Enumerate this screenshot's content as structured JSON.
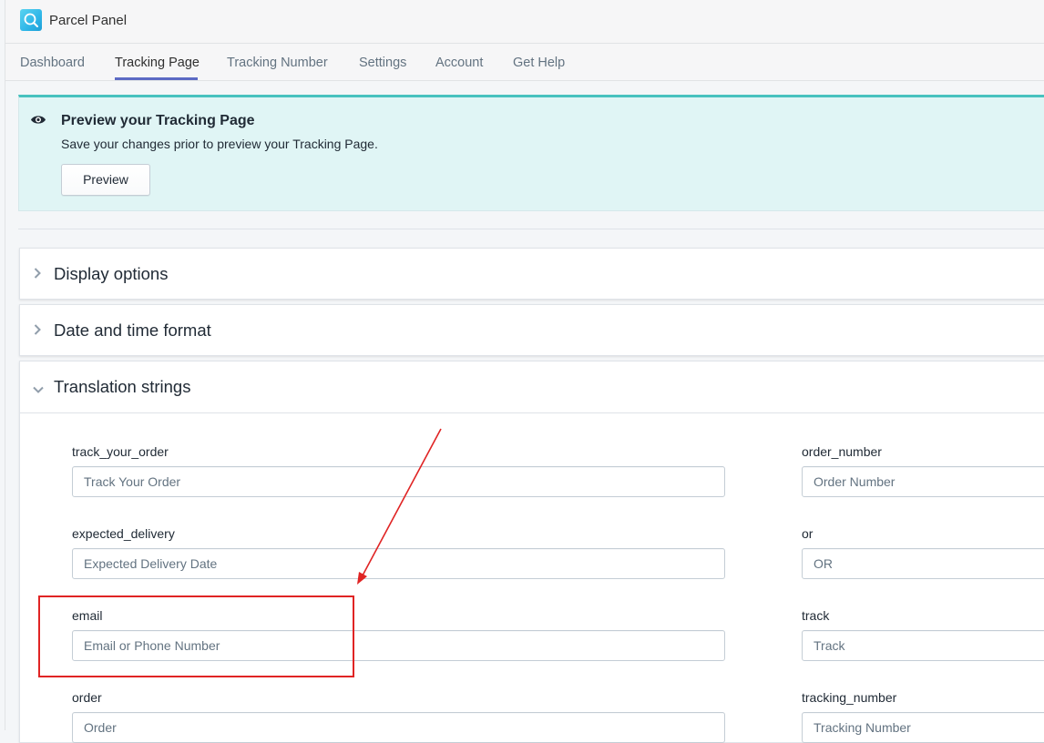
{
  "app": {
    "name": "Parcel Panel",
    "logo_icon": "parcel-panel-search-logo"
  },
  "nav": {
    "tabs": [
      {
        "label": "Dashboard",
        "active": false
      },
      {
        "label": "Tracking Page",
        "active": true
      },
      {
        "label": "Tracking Number",
        "active": false
      },
      {
        "label": "Settings",
        "active": false
      },
      {
        "label": "Account",
        "active": false
      },
      {
        "label": "Get Help",
        "active": false
      }
    ],
    "active_color": "#5c6ac4"
  },
  "banner": {
    "icon": "eye-icon",
    "title": "Preview your Tracking Page",
    "text": "Save your changes prior to preview your Tracking Page.",
    "button_label": "Preview",
    "background": "#e0f5f5",
    "accent": "#47c1bf"
  },
  "sections": {
    "display_options": {
      "title": "Display options",
      "expanded": false
    },
    "date_time_format": {
      "title": "Date and time format",
      "expanded": false
    },
    "translation_strings": {
      "title": "Translation strings",
      "expanded": true
    }
  },
  "translation_fields": {
    "track_your_order": {
      "label": "track_your_order",
      "value": "Track Your Order"
    },
    "order_number": {
      "label": "order_number",
      "value": "Order Number"
    },
    "expected_delivery": {
      "label": "expected_delivery",
      "value": "Expected Delivery Date"
    },
    "or": {
      "label": "or",
      "value": "OR"
    },
    "email": {
      "label": "email",
      "value": "Email or Phone Number"
    },
    "track": {
      "label": "track",
      "value": "Track"
    },
    "order": {
      "label": "order",
      "value": "Order"
    },
    "tracking_number": {
      "label": "tracking_number",
      "value": "Tracking Number"
    }
  },
  "annotation": {
    "color": "#e02424",
    "highlights": "email"
  }
}
